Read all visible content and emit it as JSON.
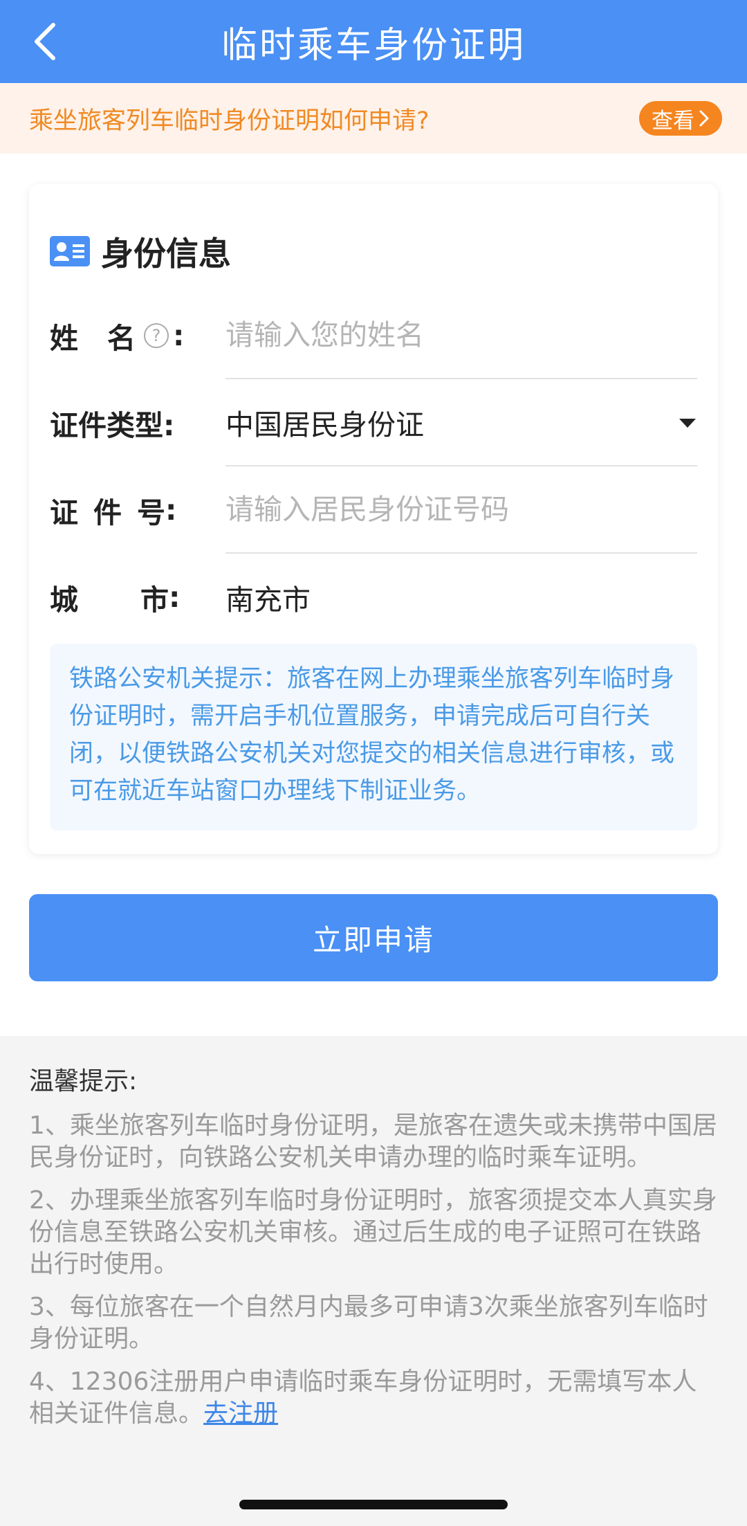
{
  "header": {
    "title": "临时乘车身份证明",
    "back_icon": "chevron-left-icon"
  },
  "notice": {
    "text": "乘坐旅客列车临时身份证明如何申请?",
    "button_label": "查看"
  },
  "card": {
    "title": "身份信息",
    "fields": {
      "name": {
        "label_chars": [
          "姓",
          "名"
        ],
        "colon": ":",
        "placeholder": "请输入您的姓名",
        "value": ""
      },
      "id_type": {
        "label": "证件类型:",
        "value": "中国居民身份证"
      },
      "id_number": {
        "label_chars": [
          "证",
          "件",
          "号"
        ],
        "colon": ":",
        "placeholder": "请输入居民身份证号码",
        "value": ""
      },
      "city": {
        "label_chars": [
          "城",
          "市"
        ],
        "colon": ":",
        "value": "南充市"
      }
    },
    "hint": "铁路公安机关提示：旅客在网上办理乘坐旅客列车临时身份证明时，需开启手机位置服务，申请完成后可自行关闭，以便铁路公安机关对您提交的相关信息进行审核，或可在就近车站窗口办理线下制证业务。"
  },
  "apply_button": "立即申请",
  "tips": {
    "title": "温馨提示:",
    "items": [
      "1、乘坐旅客列车临时身份证明，是旅客在遗失或未携带中国居民身份证时，向铁路公安机关申请办理的临时乘车证明。",
      "2、办理乘坐旅客列车临时身份证明时，旅客须提交本人真实身份信息至铁路公安机关审核。通过后生成的电子证照可在铁路出行时使用。",
      "3、每位旅客在一个自然月内最多可申请3次乘坐旅客列车临时身份证明。",
      "4、12306注册用户申请临时乘车身份证明时，无需填写本人相关证件信息。"
    ],
    "register_link": "去注册"
  },
  "colors": {
    "primary": "#4a90f5",
    "notice_orange": "#f08a24",
    "hint_blue": "#4a9ae6"
  }
}
